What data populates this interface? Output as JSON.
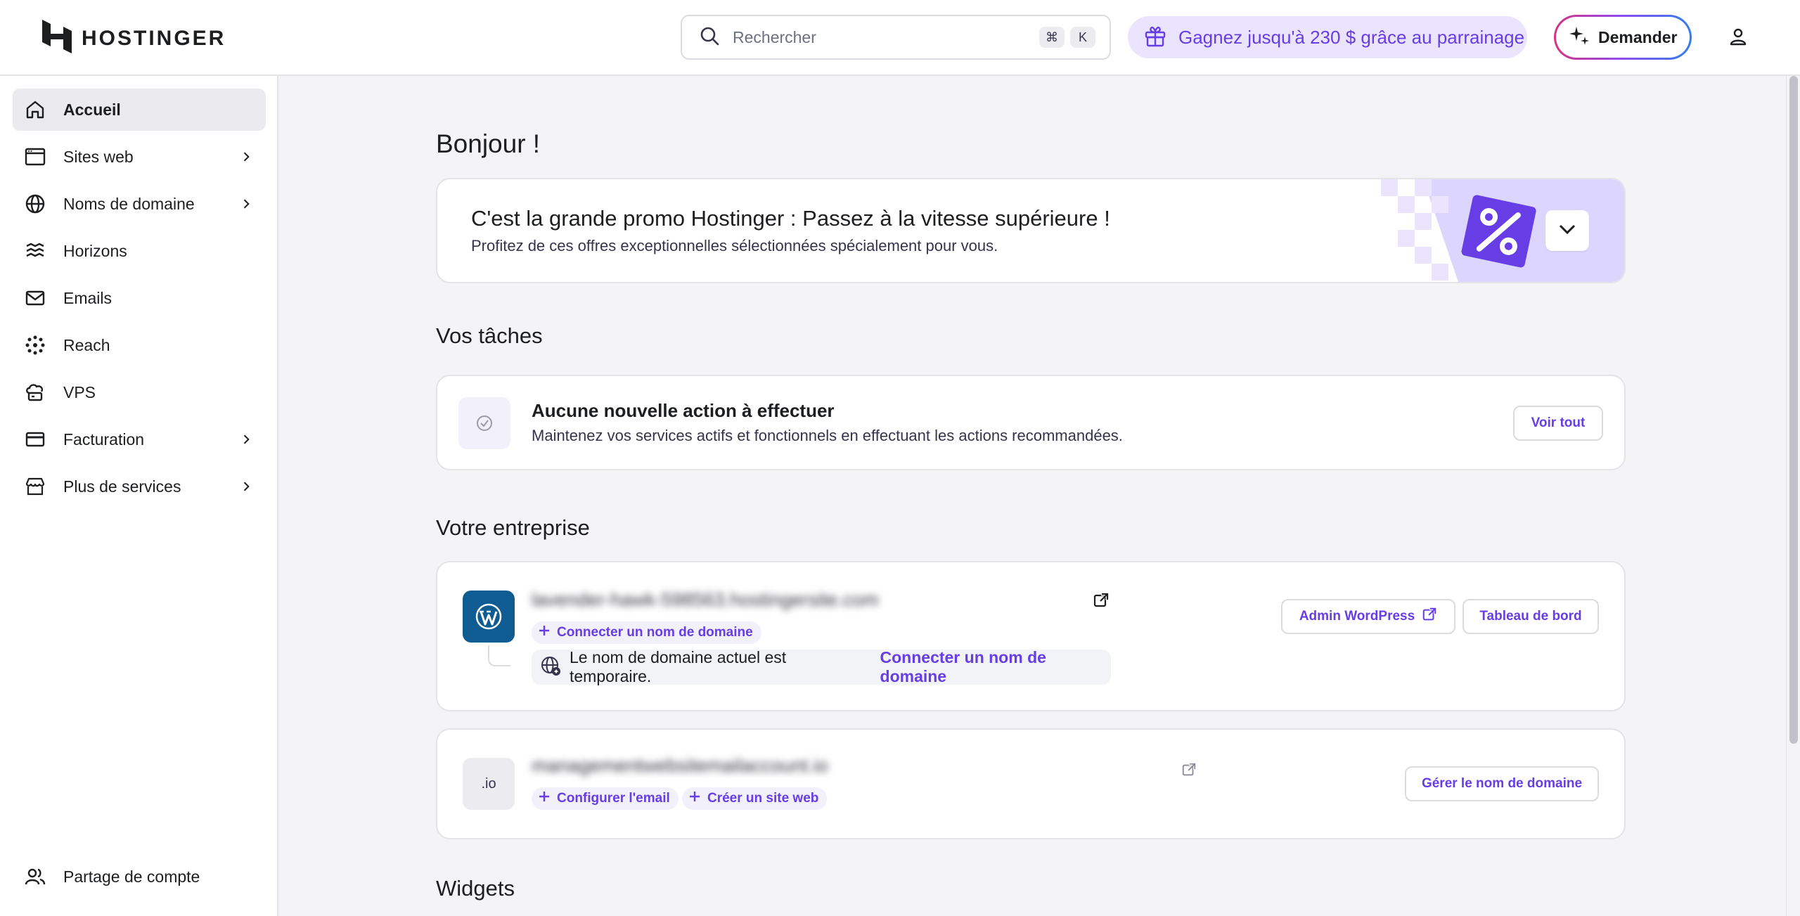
{
  "header": {
    "logo_text": "HOSTINGER",
    "search": {
      "placeholder": "Rechercher",
      "shortcut_cmd": "⌘",
      "shortcut_key": "K"
    },
    "referral_label": "Gagnez jusqu'à 230 $ grâce au parrainage",
    "ask_label": "Demander",
    "icons": [
      "hostinger-logo-icon",
      "search-icon",
      "gift-icon",
      "sparkle-icon",
      "user-icon"
    ]
  },
  "sidebar": {
    "items": [
      {
        "label": "Accueil",
        "icon": "home-icon",
        "active": true,
        "expandable": false
      },
      {
        "label": "Sites web",
        "icon": "browser-icon",
        "active": false,
        "expandable": true
      },
      {
        "label": "Noms de domaine",
        "icon": "globe-icon",
        "active": false,
        "expandable": true
      },
      {
        "label": "Horizons",
        "icon": "horizons-icon",
        "active": false,
        "expandable": false
      },
      {
        "label": "Emails",
        "icon": "mail-icon",
        "active": false,
        "expandable": false
      },
      {
        "label": "Reach",
        "icon": "reach-icon",
        "active": false,
        "expandable": false
      },
      {
        "label": "VPS",
        "icon": "cloud-server-icon",
        "active": false,
        "expandable": false
      },
      {
        "label": "Facturation",
        "icon": "credit-card-icon",
        "active": false,
        "expandable": true
      },
      {
        "label": "Plus de services",
        "icon": "store-icon",
        "active": false,
        "expandable": true
      }
    ],
    "footer_item": {
      "label": "Partage de compte",
      "icon": "users-icon"
    }
  },
  "main": {
    "greeting": "Bonjour !",
    "promo": {
      "title": "C'est la grande promo Hostinger : Passez à la vitesse supérieure !",
      "subtitle": "Profitez de ces offres exceptionnelles sélectionnées spécialement pour vous."
    },
    "tasks": {
      "heading": "Vos tâches",
      "title": "Aucune nouvelle action à effectuer",
      "subtitle": "Maintenez vos services actifs et fonctionnels en effectuant les actions recommandées.",
      "view_all": "Voir tout"
    },
    "business": {
      "heading": "Votre entreprise",
      "site": {
        "domain": "lavender-hawk-598563.hostingersite.com",
        "connect_chip": "Connecter un nom de domaine",
        "notice_text": "Le nom de domaine actuel est temporaire.",
        "notice_link": "Connecter un nom de domaine",
        "admin_button": "Admin WordPress",
        "dashboard_button": "Tableau de bord"
      },
      "domain": {
        "tld_badge": ".io",
        "name": "managementwebsitemailaccount.io",
        "configure_email": "Configurer l'email",
        "create_site": "Créer un site web",
        "manage_button": "Gérer le nom de domaine"
      }
    },
    "widgets_heading": "Widgets"
  },
  "colors": {
    "accent": "#673de6",
    "accent_soft": "#ebe4ff",
    "wordpress": "#0f5c92"
  }
}
